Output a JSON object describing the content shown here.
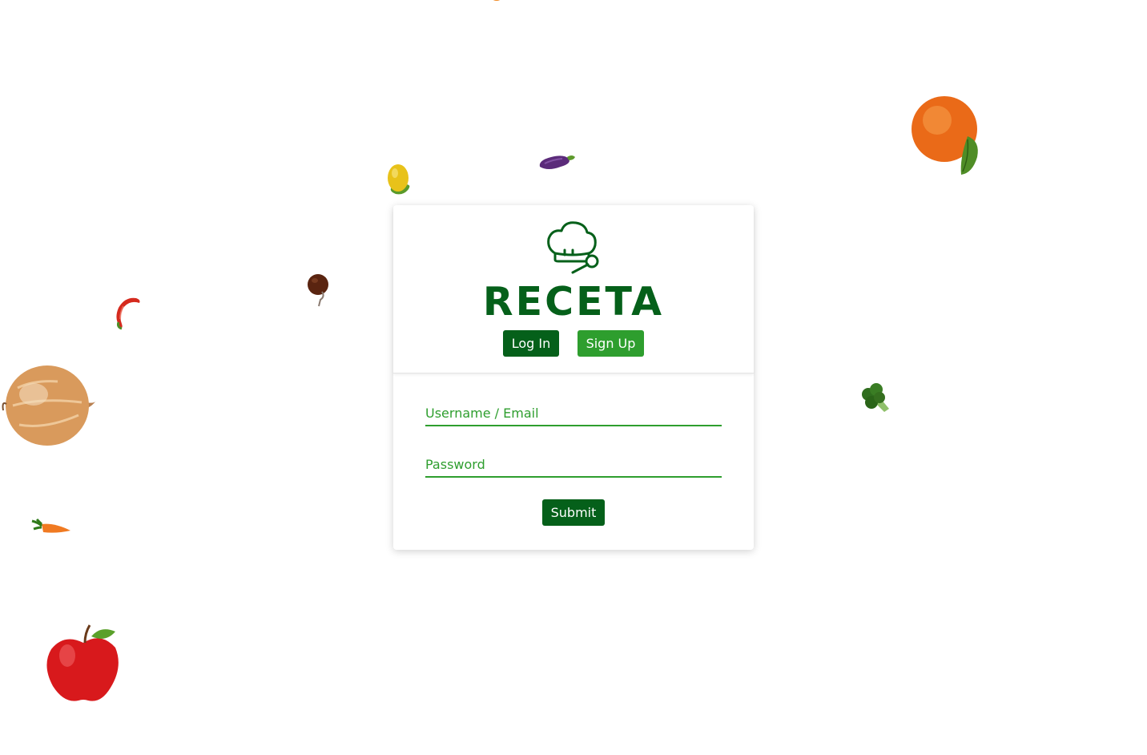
{
  "brand": {
    "name": "RECETA",
    "logo_icon": "chef-hat-icon",
    "primary_color": "#05601a",
    "accent_color": "#2e9e2e"
  },
  "tabs": {
    "login_label": "Log In",
    "signup_label": "Sign Up",
    "active": "login"
  },
  "form": {
    "username_placeholder": "Username / Email",
    "password_placeholder": "Password",
    "submit_label": "Submit"
  },
  "decorations": [
    "tangerine-icon",
    "lemon-icon",
    "eggplant-icon",
    "chestnut-icon",
    "hot-pepper-icon",
    "onion-icon",
    "carrot-icon",
    "apple-icon",
    "broccoli-icon",
    "orange-icon"
  ]
}
